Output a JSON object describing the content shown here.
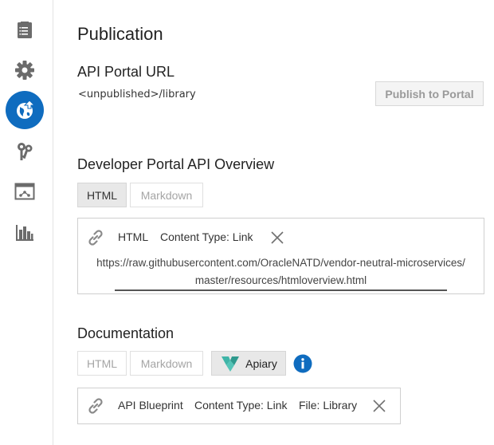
{
  "sidebar": {
    "items": [
      {
        "name": "document-list-icon",
        "active": false
      },
      {
        "name": "gear-icon",
        "active": false
      },
      {
        "name": "globe-upload-icon",
        "active": true
      },
      {
        "name": "keys-icon",
        "active": false
      },
      {
        "name": "app-window-icon",
        "active": false
      },
      {
        "name": "bar-chart-icon",
        "active": false
      }
    ],
    "active_color": "#0f6cbf"
  },
  "page": {
    "title": "Publication"
  },
  "portal_url": {
    "heading": "API Portal URL",
    "value": "<unpublished>/library",
    "publish_label": "Publish to Portal"
  },
  "overview": {
    "heading": "Developer Portal API Overview",
    "tabs": [
      {
        "label": "HTML",
        "selected": true
      },
      {
        "label": "Markdown",
        "selected": false
      }
    ],
    "card": {
      "format": "HTML",
      "content_type": "Content Type: Link",
      "url_line1": "https://raw.githubusercontent.com/OracleNATD/vendor-neutral-microservices/",
      "url_line2": "master/resources/htmloverview.html"
    }
  },
  "documentation": {
    "heading": "Documentation",
    "tabs": [
      {
        "label": "HTML",
        "selected": false
      },
      {
        "label": "Markdown",
        "selected": false
      },
      {
        "label": "Apiary",
        "selected": true
      }
    ],
    "card": {
      "format": "API Blueprint",
      "content_type": "Content Type: Link",
      "file": "File: Library"
    }
  },
  "colors": {
    "info": "#0f6cbf",
    "apiary_teal": "#3fb5a8"
  }
}
